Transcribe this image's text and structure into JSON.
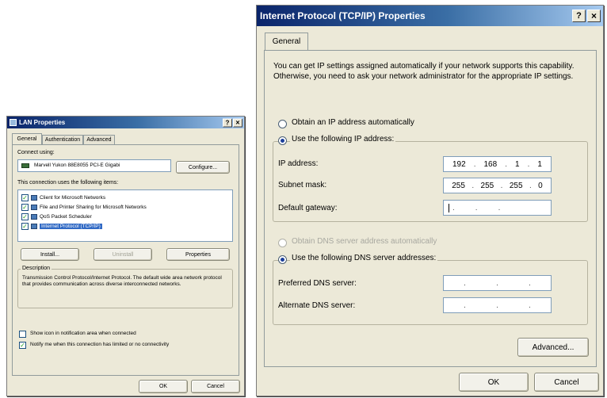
{
  "lan": {
    "title": "LAN Properties",
    "help": "?",
    "close": "×",
    "tabs": [
      "General",
      "Authentication",
      "Advanced"
    ],
    "connect_using": "Connect using:",
    "adapter": "Marvell Yukon 88E8055 PCI-E Gigabi",
    "configure": "Configure...",
    "items_label": "This connection uses the following items:",
    "items": [
      {
        "label": "Client for Microsoft Networks",
        "checked": true,
        "selected": false
      },
      {
        "label": "File and Printer Sharing for Microsoft Networks",
        "checked": true,
        "selected": false
      },
      {
        "label": "QoS Packet Scheduler",
        "checked": true,
        "selected": false
      },
      {
        "label": "Internet Protocol (TCP/IP)",
        "checked": true,
        "selected": true
      }
    ],
    "install": "Install...",
    "uninstall": "Uninstall",
    "properties": "Properties",
    "description_label": "Description",
    "description": "Transmission Control Protocol/Internet Protocol. The default wide area network protocol that provides communication across diverse interconnected networks.",
    "show_icon": "Show icon in notification area when connected",
    "notify": "Notify me when this connection has limited or no connectivity",
    "ok": "OK",
    "cancel": "Cancel"
  },
  "tcp": {
    "title": "Internet Protocol (TCP/IP) Properties",
    "help": "?",
    "close": "×",
    "tab": "General",
    "intro": "You can get IP settings assigned automatically if your network supports this capability. Otherwise, you need to ask your network administrator for the appropriate IP settings.",
    "obtain_ip": "Obtain an IP address automatically",
    "use_ip": "Use the following IP address:",
    "ip_label": "IP address:",
    "ip": [
      "192",
      "168",
      "1",
      "1"
    ],
    "mask_label": "Subnet mask:",
    "mask": [
      "255",
      "255",
      "255",
      "0"
    ],
    "gateway_label": "Default gateway:",
    "obtain_dns": "Obtain DNS server address automatically",
    "use_dns": "Use the following DNS server addresses:",
    "pref_dns_label": "Preferred DNS server:",
    "alt_dns_label": "Alternate DNS server:",
    "advanced": "Advanced...",
    "ok": "OK",
    "cancel": "Cancel"
  }
}
